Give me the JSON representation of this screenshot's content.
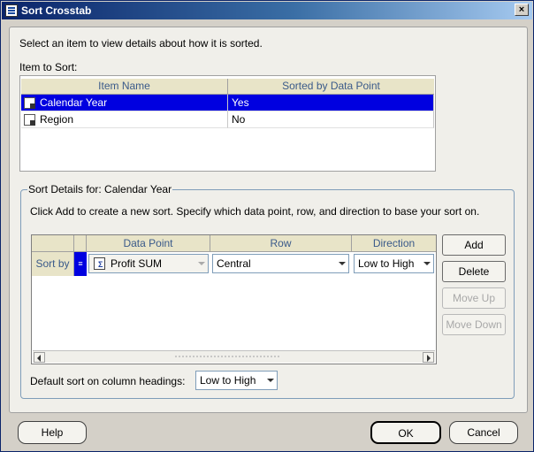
{
  "window": {
    "title": "Sort Crosstab",
    "close_label": "×"
  },
  "instructions": "Select an item to view details about how it is sorted.",
  "item_to_sort": {
    "label": "Item to Sort:",
    "columns": [
      "Item Name",
      "Sorted by Data Point"
    ],
    "rows": [
      {
        "name": "Calendar Year",
        "sorted": "Yes",
        "selected": true
      },
      {
        "name": "Region",
        "sorted": "No",
        "selected": false
      }
    ]
  },
  "sort_details": {
    "legend": "Sort Details for: Calendar Year",
    "help_text": "Click Add to create a new sort. Specify which data point, row, and direction to base your sort on.",
    "columns": [
      "",
      "",
      "Data Point",
      "Row",
      "Direction"
    ],
    "rows": [
      {
        "label": "Sort by",
        "marker": "≡",
        "data_point": "Profit SUM",
        "row": "Central",
        "direction": "Low to High"
      }
    ],
    "default_sort_label": "Default sort on column headings:",
    "default_sort_value": "Low to High"
  },
  "side_buttons": {
    "add": "Add",
    "delete": "Delete",
    "move_up": "Move Up",
    "move_down": "Move Down"
  },
  "footer": {
    "help": "Help",
    "ok": "OK",
    "cancel": "Cancel"
  }
}
